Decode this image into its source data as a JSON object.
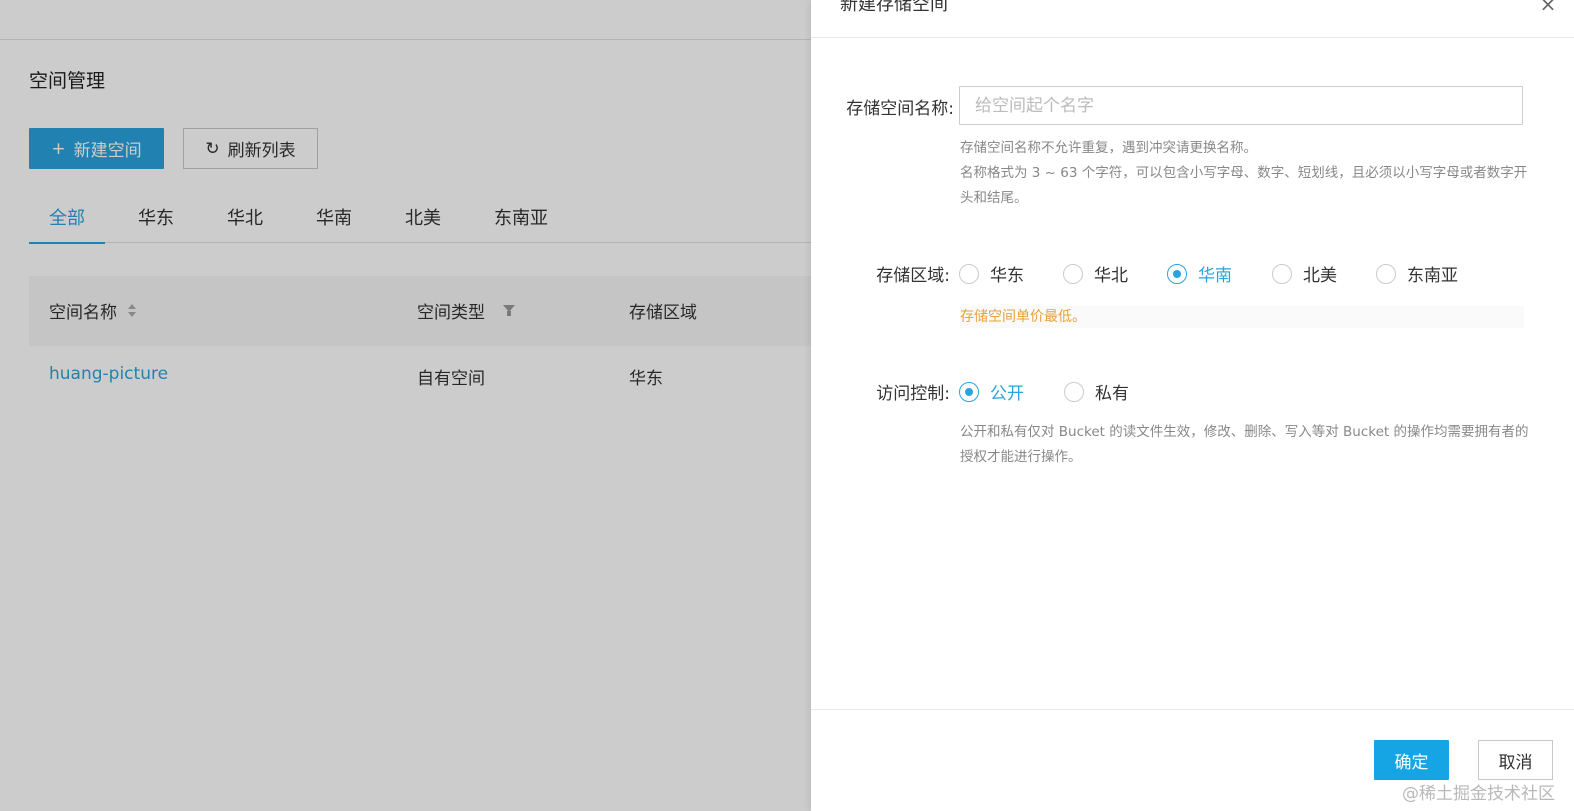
{
  "page": {
    "title": "空间管理",
    "new_button": "新建空间",
    "new_icon": "+",
    "refresh_button": "刷新列表",
    "refresh_icon": "↻",
    "tabs": [
      "全部",
      "华东",
      "华北",
      "华南",
      "北美",
      "东南亚"
    ],
    "active_tab": "全部",
    "table": {
      "columns": [
        "空间名称",
        "空间类型",
        "存储区域"
      ],
      "rows": [
        {
          "name": "huang-picture",
          "type": "自有空间",
          "region": "华东"
        }
      ]
    }
  },
  "drawer": {
    "title": "新建存储空间",
    "close_icon": "×",
    "name_label": "存储空间名称:",
    "name_placeholder": "给空间起个名字",
    "name_value": "",
    "name_hint_1": "存储空间名称不允许重复，遇到冲突请更换名称。",
    "name_hint_2": "名称格式为 3 ~ 63 个字符，可以包含小写字母、数字、短划线，且必须以小写字母或者数字开头和结尾。",
    "region_label": "存储区域:",
    "regions": [
      "华东",
      "华北",
      "华南",
      "北美",
      "东南亚"
    ],
    "region_selected": "华南",
    "region_note": "存储空间单价最低。",
    "access_label": "访问控制:",
    "access_options": [
      "公开",
      "私有"
    ],
    "access_selected": "公开",
    "access_hint": "公开和私有仅对 Bucket 的读文件生效，修改、删除、写入等对 Bucket 的操作均需要拥有者的授权才能进行操作。",
    "ok_button": "确定",
    "cancel_button": "取消"
  },
  "watermark": "@稀土掘金技术社区",
  "colors": {
    "accent": "#2aa3de",
    "primary_button": "#16a5e4",
    "warning_text": "#e6a23c",
    "overlay": "rgba(0,0,0,0.2)"
  }
}
